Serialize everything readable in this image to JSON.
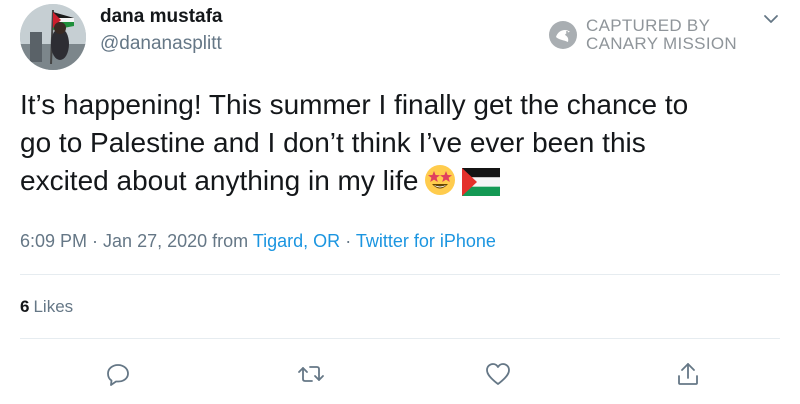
{
  "author": {
    "display_name": "dana mustafa",
    "username": "@dananasplitt"
  },
  "watermark": {
    "line1": "CAPTURED BY",
    "line2": "CANARY MISSION"
  },
  "tweet": {
    "text_line1": "It’s happening! This summer I finally get the chance to",
    "text_line2": "go to Palestine and I don’t think I’ve ever been this",
    "text_line3": "excited about anything in my life",
    "emojis": [
      "star-struck-emoji",
      "palestine-flag-emoji"
    ]
  },
  "meta": {
    "time": "6:09 PM",
    "sep1": " · ",
    "date": "Jan 27, 2020",
    "from_label": " from ",
    "location": "Tigard, OR",
    "sep2": " · ",
    "source": "Twitter for iPhone"
  },
  "stats": {
    "likes_count": "6",
    "likes_label": "Likes"
  },
  "actions": {
    "icons": [
      "reply-icon",
      "retweet-icon",
      "like-icon",
      "share-icon"
    ]
  },
  "colors": {
    "link": "#1b95e0",
    "secondary_text": "#657786",
    "primary_text": "#14171a",
    "divider": "#e6ecf0"
  }
}
